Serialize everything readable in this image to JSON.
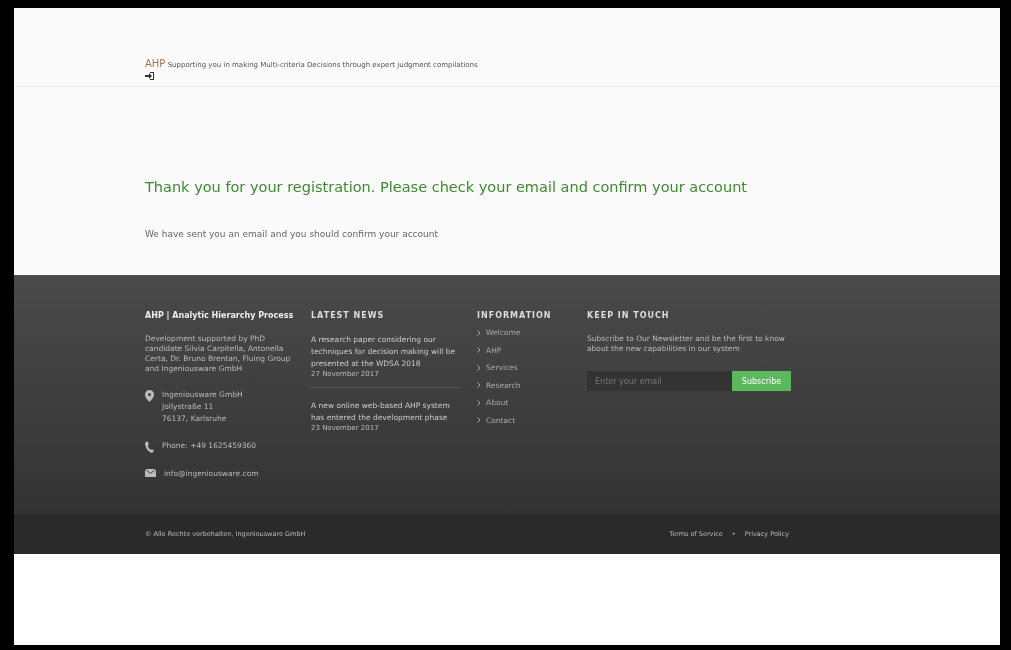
{
  "header": {
    "logo": "AHP",
    "tagline": "Supporting you in making Multi-criteria Decisions through expert judgment compilations"
  },
  "main": {
    "heading": "Thank you for your registration. Please check your email and confirm your account",
    "message": "We have sent you an email and you should confirm your account"
  },
  "footer": {
    "about": {
      "title": "AHP | Analytic Hierarchy Process",
      "text": "Development supported by PhD candidate Silvia Carpitella, Antonella Certa, Dr. Bruno Brentan, Fluing Group and Ingeniousware GmbH",
      "contacts": [
        {
          "kind": "address",
          "lines": [
            "Ingeniousware GmbH",
            "Jollystraße 11",
            "76137, Karlsruhe"
          ]
        },
        {
          "kind": "phone",
          "lines": [
            "Phone: +49 1625459360"
          ]
        },
        {
          "kind": "email",
          "lines": [
            "info@ingeniousware.com"
          ]
        }
      ]
    },
    "news": {
      "title": "LATEST NEWS",
      "items": [
        {
          "text": "A research paper considering our techniques for decision making will be presented at the WDSA 2018",
          "date": "27 November 2017"
        },
        {
          "text": "A new online web-based AHP system has entered the development phase",
          "date": "23 November 2017"
        }
      ]
    },
    "information": {
      "title": "INFORMATION",
      "links": [
        "Welcome",
        "AHP",
        "Services",
        "Research",
        "About",
        "Contact"
      ]
    },
    "keep_in_touch": {
      "title": "KEEP IN TOUCH",
      "text": "Subscribe to Our Newsletter and be the first to know about the new capabilities in our system",
      "placeholder": "Enter your email",
      "button": "Subscribe"
    }
  },
  "bottom_bar": {
    "copyright": "© Alle Rechte vorbehalten, Ingeniousware GmbH",
    "links": [
      "Terms of Service",
      "Privacy Policy"
    ],
    "separator": "•"
  }
}
